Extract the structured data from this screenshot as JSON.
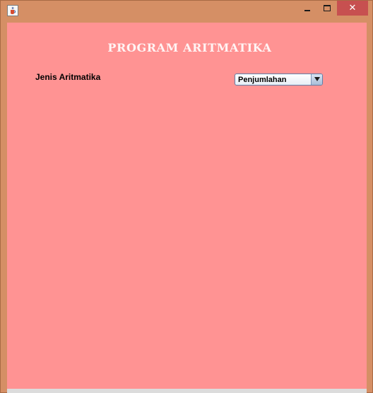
{
  "window": {
    "title_icon": "java-cup-icon",
    "controls": {
      "minimize": "minimize-icon",
      "maximize": "maximize-icon",
      "close": "✕"
    }
  },
  "form": {
    "heading": "PROGRAM ARITMATIKA",
    "jenis_label": "Jenis Aritmatika",
    "jenis_selected": "Penjumlahan"
  },
  "colors": {
    "window_frame": "#d58f65",
    "panel_background": "#ff9393",
    "close_button": "#c75050"
  }
}
